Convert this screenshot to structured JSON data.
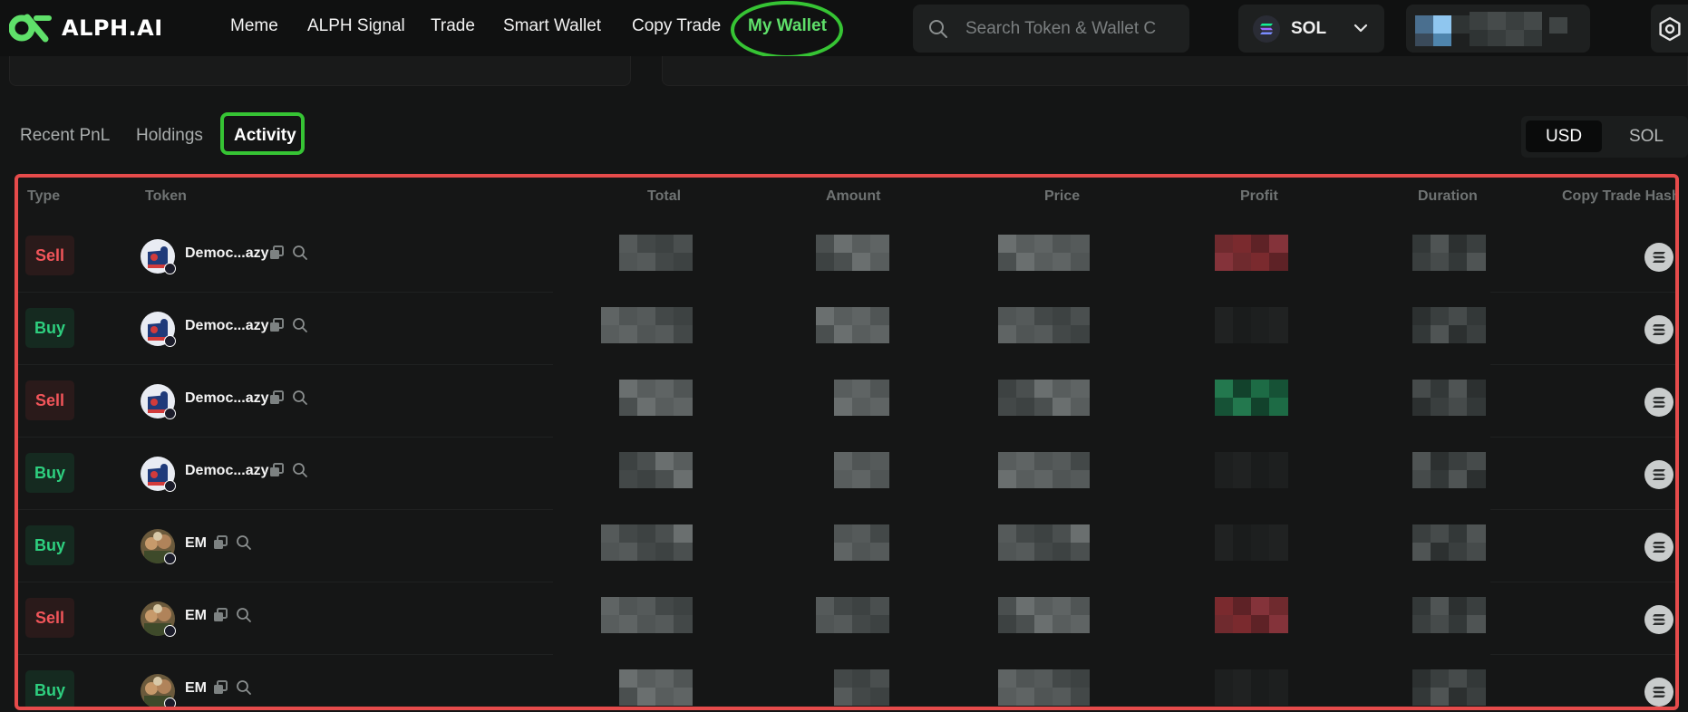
{
  "brand": {
    "name": "ALPH.AI",
    "accent": "#5fe06a"
  },
  "nav": {
    "items": [
      {
        "label": "Meme"
      },
      {
        "label": "ALPH Signal"
      },
      {
        "label": "Trade"
      },
      {
        "label": "Smart Wallet"
      },
      {
        "label": "Copy Trade"
      },
      {
        "label": "My Wallet",
        "active": true
      }
    ]
  },
  "search": {
    "placeholder": "Search Token & Wallet C",
    "icon": "search-icon"
  },
  "chain_selector": {
    "label": "SOL",
    "icon": "solana-icon"
  },
  "wallet": {
    "address": "",
    "obscured": true
  },
  "settings": {
    "icon": "settings-icon"
  },
  "tabs": [
    {
      "label": "Recent PnL"
    },
    {
      "label": "Holdings"
    },
    {
      "label": "Activity",
      "active": true
    }
  ],
  "currency_toggle": {
    "options": [
      "USD",
      "SOL"
    ],
    "selected": "USD"
  },
  "table": {
    "headers": {
      "type": "Type",
      "token": "Token",
      "total": "Total",
      "amount": "Amount",
      "price": "Price",
      "profit": "Profit",
      "duration": "Duration",
      "hash": "Copy Trade Hash"
    },
    "rows": [
      {
        "type": "Sell",
        "token": "Democ...azy",
        "profit_state": "loss"
      },
      {
        "type": "Buy",
        "token": "Democ...azy",
        "profit_state": "none"
      },
      {
        "type": "Sell",
        "token": "Democ...azy",
        "profit_state": "gain"
      },
      {
        "type": "Buy",
        "token": "Democ...azy",
        "profit_state": "none"
      },
      {
        "type": "Buy",
        "token": "EM",
        "profit_state": "none"
      },
      {
        "type": "Sell",
        "token": "EM",
        "profit_state": "loss"
      },
      {
        "type": "Buy",
        "token": "EM",
        "profit_state": "none"
      }
    ],
    "colors": {
      "sell": "#f1555a",
      "buy": "#2ecf7f",
      "loss": "#7a2a2e",
      "gain": "#1d6b45"
    }
  }
}
